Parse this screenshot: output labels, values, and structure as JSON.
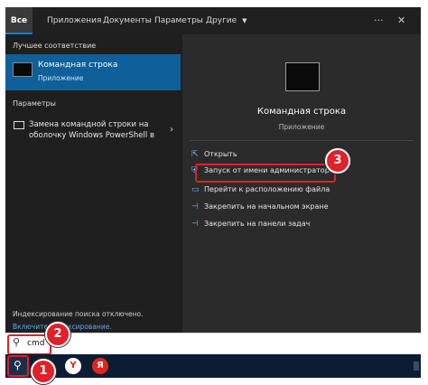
{
  "tabs": [
    {
      "label": "Все",
      "active": true
    },
    {
      "label": "Приложения"
    },
    {
      "label": "Документы"
    },
    {
      "label": "Параметры"
    },
    {
      "label": "Другие"
    }
  ],
  "best_match": {
    "section": "Лучшее соответствие",
    "title": "Командная строка",
    "subtitle": "Приложение"
  },
  "settings": {
    "section": "Параметры",
    "line1": "Замена командной строки на",
    "line2": "оболочку Windows PowerShell в"
  },
  "index_notice": {
    "line1": "Индексирование поиска отключено.",
    "link": "Включите индексирование."
  },
  "preview": {
    "title": "Командная строка",
    "subtitle": "Приложение"
  },
  "actions": [
    {
      "label": "Открыть",
      "icon": "open-icon"
    },
    {
      "label": "Запуск от имени администратора",
      "icon": "run-as-admin-icon"
    },
    {
      "label": "Перейти к расположению файла",
      "icon": "folder-icon"
    },
    {
      "label": "Закрепить на начальном экране",
      "icon": "pin-icon"
    },
    {
      "label": "Закрепить на панели задач",
      "icon": "pin-icon"
    }
  ],
  "search": {
    "value": "cmd"
  },
  "badges": {
    "one": "1",
    "two": "2",
    "three": "3"
  },
  "taskbar": {
    "yandex_browser": "Y",
    "yandex": "Я"
  },
  "colors": {
    "accent": "#0f5f99",
    "highlight": "#e0202a",
    "link": "#5ea9f2"
  }
}
